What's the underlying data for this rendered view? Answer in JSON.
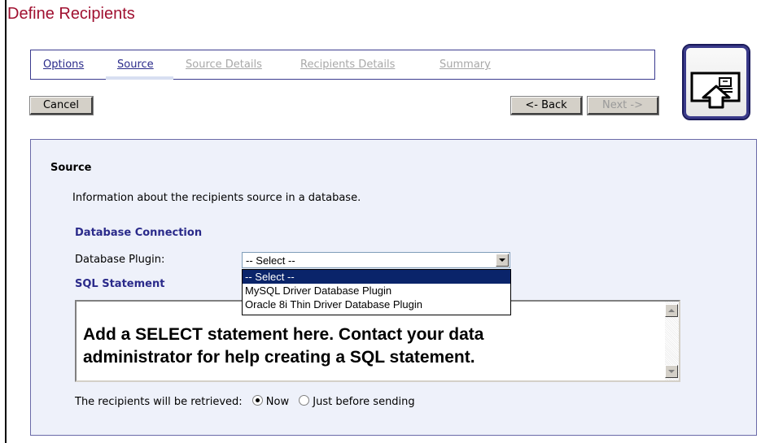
{
  "page": {
    "title": "Define Recipients"
  },
  "wizard": {
    "steps": [
      {
        "label": "Options",
        "state": "link"
      },
      {
        "label": "Source",
        "state": "current"
      },
      {
        "label": "Source Details",
        "state": "disabled"
      },
      {
        "label": "Recipients Details",
        "state": "disabled"
      },
      {
        "label": "Summary",
        "state": "disabled"
      }
    ],
    "icon": "export-document-icon"
  },
  "actions": {
    "cancel_label": "Cancel",
    "back_label": "<- Back",
    "next_label": "Next ->"
  },
  "section": {
    "title": "Source",
    "description": "Information about the recipients source in a database."
  },
  "db": {
    "heading": "Database Connection",
    "plugin_label": "Database Plugin:",
    "selected": "-- Select --",
    "options": [
      "-- Select --",
      "MySQL Driver Database Plugin",
      "Oracle 8i Thin Driver Database Plugin"
    ]
  },
  "sql": {
    "heading": "SQL Statement",
    "placeholder_line1": "Add a SELECT statement here. Contact your data",
    "placeholder_line2": "administrator for help creating a SQL statement."
  },
  "retrieve": {
    "label": "The recipients will be retrieved:",
    "options": [
      "Now",
      "Just before sending"
    ],
    "selected": "Now"
  },
  "colors": {
    "title": "#a01030",
    "heading": "#2a2a8a",
    "panel": "#eef1fa",
    "selection": "#0a246a"
  }
}
